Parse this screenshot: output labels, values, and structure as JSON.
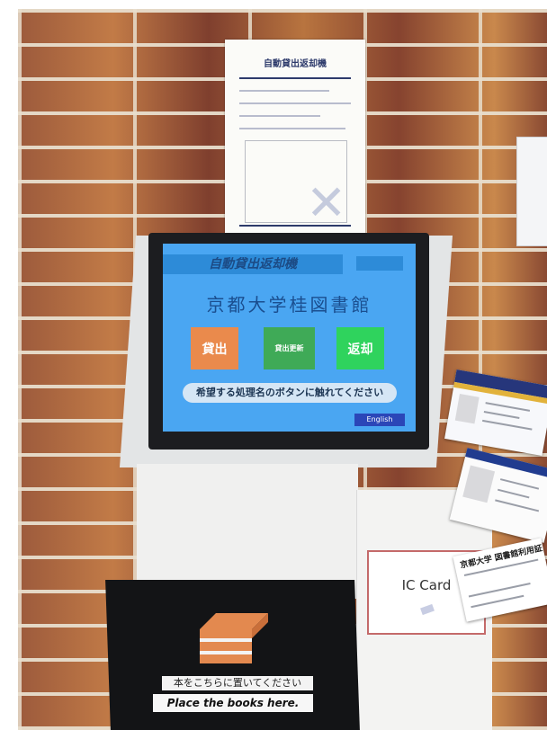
{
  "poster": {
    "title": "自動貸出返却機"
  },
  "kiosk": {
    "screen_header": "自動貸出返却機",
    "library_name": "京都大学桂図書館",
    "buttons": {
      "lend": "貸出",
      "renew": "貸出更新",
      "return": "返却"
    },
    "prompt": "希望する処理名のボタンに触れてください",
    "language_button": "English"
  },
  "book_area": {
    "label_ja": "本をこちらに置いてください",
    "label_en": "Place the books here."
  },
  "card_reader": {
    "label": "IC Card"
  },
  "cards": {
    "library_card_title": "京都大学 図書館利用証"
  },
  "colors": {
    "screen_bg": "#4aa6f2",
    "lend_button": "#ea8a4c",
    "renew_button": "#3faa57",
    "return_button": "#2fd35d",
    "english_button": "#2b46b8"
  }
}
